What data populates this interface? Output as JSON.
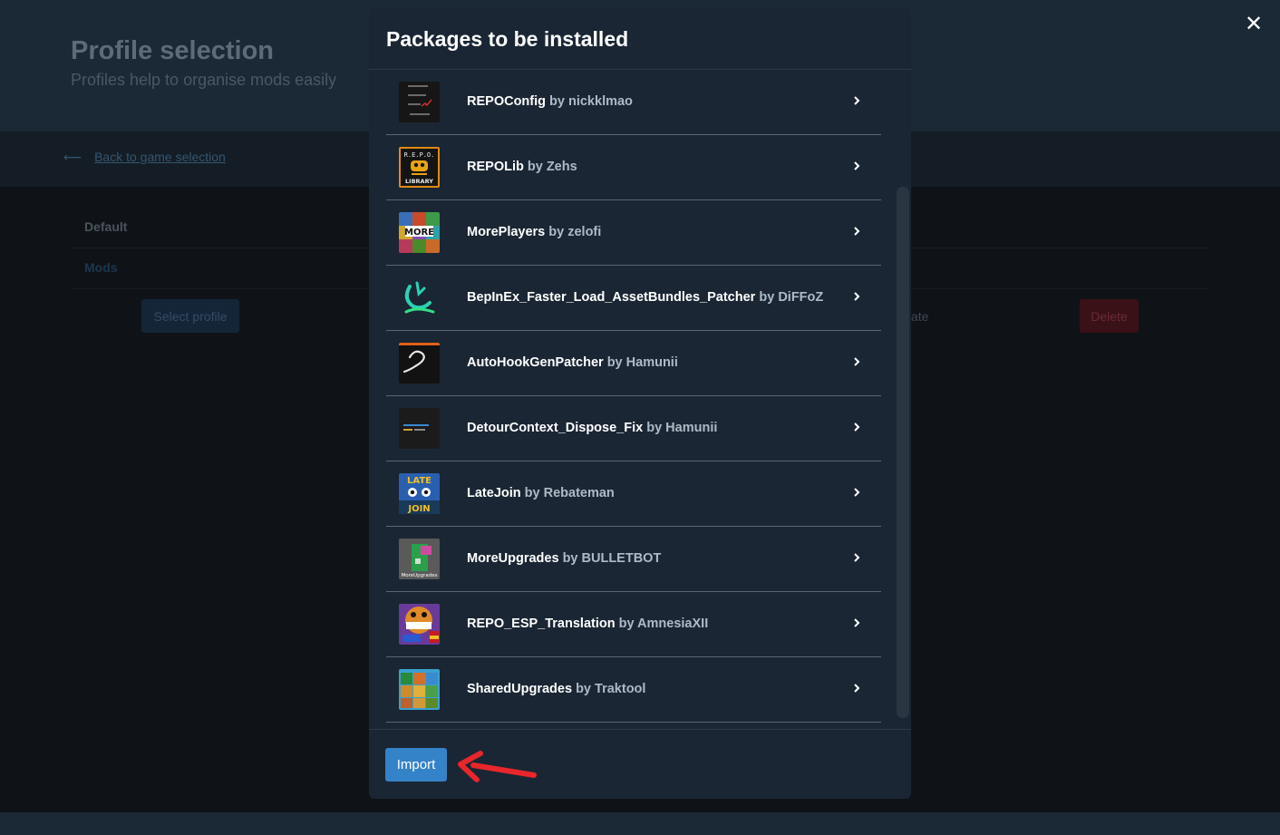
{
  "background": {
    "title": "Profile selection",
    "subtitle": "Profiles help to organise mods easily",
    "back_link": "Back to game selection",
    "rows": [
      "Default",
      "Mods"
    ],
    "select_profile": "Select profile",
    "partial_text": "ate",
    "delete": "Delete"
  },
  "close_icon": "✕",
  "modal": {
    "title": "Packages to be installed",
    "by_word": "by",
    "packages": [
      {
        "name": "REPOConfig",
        "author": "nickklmao"
      },
      {
        "name": "REPOLib",
        "author": "Zehs"
      },
      {
        "name": "MorePlayers",
        "author": "zelofi"
      },
      {
        "name": "BepInEx_Faster_Load_AssetBundles_Patcher",
        "author": "DiFFoZ"
      },
      {
        "name": "AutoHookGenPatcher",
        "author": "Hamunii"
      },
      {
        "name": "DetourContext_Dispose_Fix",
        "author": "Hamunii"
      },
      {
        "name": "LateJoin",
        "author": "Rebateman"
      },
      {
        "name": "MoreUpgrades",
        "author": "BULLETBOT"
      },
      {
        "name": "REPO_ESP_Translation",
        "author": "AmnesiaXII"
      },
      {
        "name": "SharedUpgrades",
        "author": "Traktool"
      }
    ],
    "import_label": "Import"
  },
  "thumb_text": {
    "repolib_top": "R.E.P.O.",
    "repolib_bottom": "LIBRARY",
    "moreplayers": "MORE",
    "latejoin_top": "LATE",
    "latejoin_bottom": "JOIN",
    "moreupgrades": "MoreUpgrades"
  },
  "colors": {
    "modal_bg": "#1a2633",
    "primary": "#3483c9",
    "annotation_arrow": "#e8262b"
  }
}
